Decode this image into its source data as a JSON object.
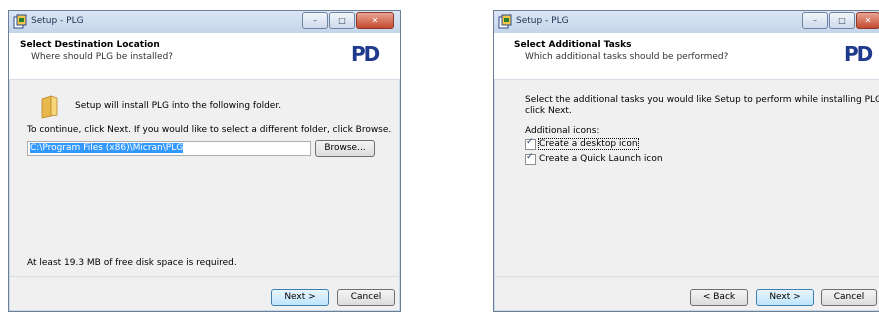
{
  "left_window": {
    "title": "Setup - PLG",
    "header_title": "Select Destination Location",
    "header_subtitle": "Where should PLG be installed?",
    "logo_text": "PD",
    "intro_text": "Setup will install PLG into the following folder.",
    "continue_text": "To continue, click Next. If you would like to select a different folder, click Browse.",
    "path_value": "C:\\Program Files (x86)\\Micran\\PLG",
    "browse_label": "Browse...",
    "disk_space_text": "At least 19.3 MB of free disk space is required.",
    "next_label": "Next >",
    "cancel_label": "Cancel"
  },
  "right_window": {
    "title": "Setup - PLG",
    "header_title": "Select Additional Tasks",
    "header_subtitle": "Which additional tasks should be performed?",
    "logo_text": "PD",
    "instruction_line1": "Select the additional tasks you would like Setup to perform while installing PLG, then",
    "instruction_line2": "click Next.",
    "group_label": "Additional icons:",
    "task1_label": "Create a desktop icon",
    "task2_label": "Create a Quick Launch icon",
    "task1_checked": true,
    "task2_checked": true,
    "back_label": "< Back",
    "next_label": "Next >",
    "cancel_label": "Cancel"
  },
  "window_buttons": {
    "minimize": "–",
    "maximize": "□",
    "close": "✕"
  },
  "colors": {
    "accent": "#1f3a8c",
    "selection": "#3399ff",
    "titlebar": "#c5d5ea"
  }
}
